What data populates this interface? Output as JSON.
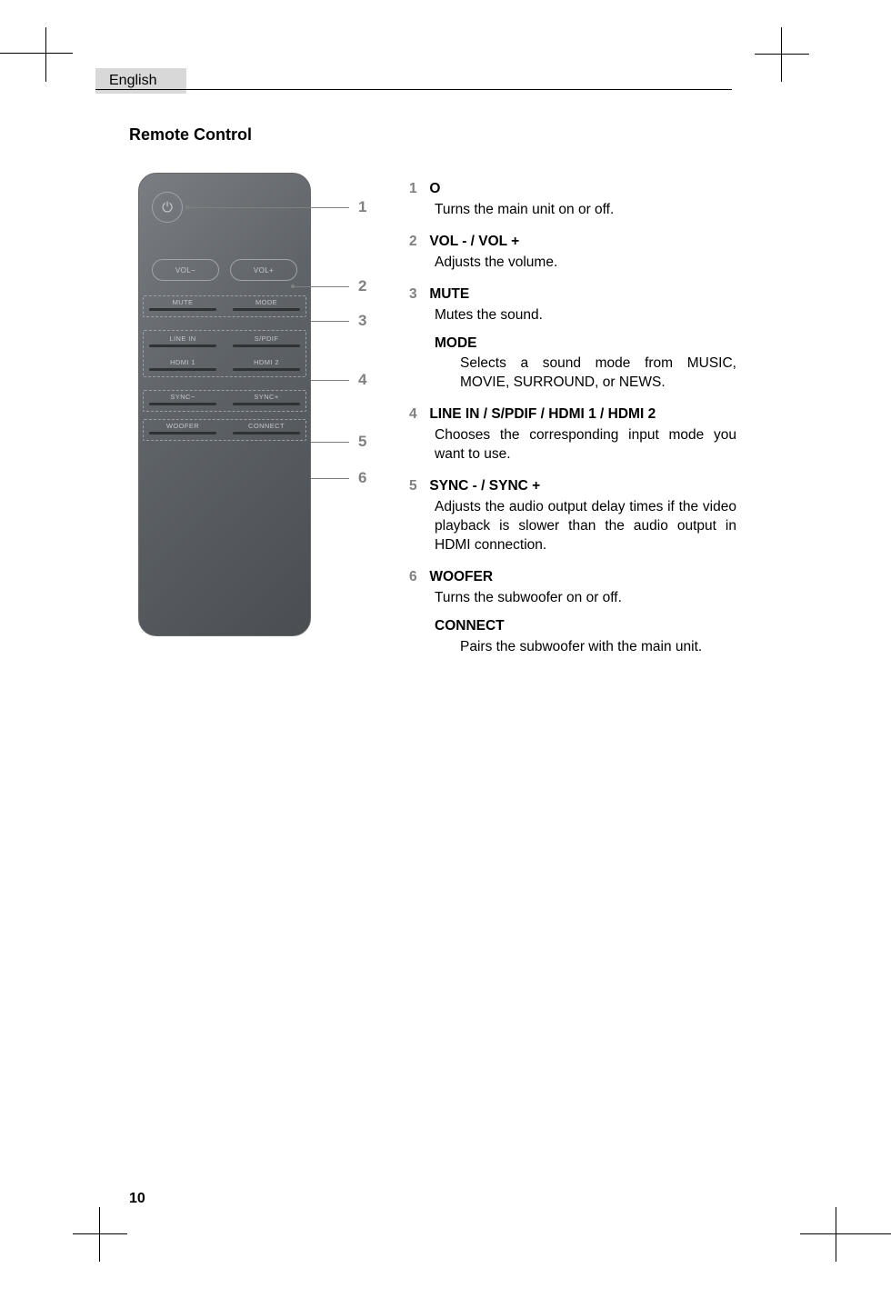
{
  "header": {
    "language": "English"
  },
  "section_title": "Remote Control",
  "remote": {
    "power_glyph": "⏻",
    "rows": {
      "vol": {
        "left": "VOL−",
        "right": "VOL+"
      },
      "mute_mode": {
        "left": "MUTE",
        "right": "MODE"
      },
      "input1": {
        "left": "LINE IN",
        "right": "S/PDIF"
      },
      "input2": {
        "left": "HDMI 1",
        "right": "HDMI 2"
      },
      "sync": {
        "left": "SYNC−",
        "right": "SYNC+"
      },
      "woofer": {
        "left": "WOOFER",
        "right": "CONNECT"
      }
    }
  },
  "callouts": {
    "c1": "1",
    "c2": "2",
    "c3": "3",
    "c4": "4",
    "c5": "5",
    "c6": "6"
  },
  "descriptions": [
    {
      "num": "1",
      "title": "O",
      "body": "Turns the main unit on or off."
    },
    {
      "num": "2",
      "title": "VOL - / VOL +",
      "body": "Adjusts the volume."
    },
    {
      "num": "3",
      "title": "MUTE",
      "body": "Mutes the sound.",
      "sub": {
        "title": "MODE",
        "body": "Selects a sound mode from MUSIC, MOVIE, SURROUND, or NEWS."
      }
    },
    {
      "num": "4",
      "title": "LINE IN / S/PDIF / HDMI 1 / HDMI 2",
      "body": "Chooses the corresponding input mode you want to use."
    },
    {
      "num": "5",
      "title": "SYNC - / SYNC +",
      "body": "Adjusts the audio output delay times if the video playback is slower than the audio output in HDMI connection."
    },
    {
      "num": "6",
      "title": "WOOFER",
      "body": "Turns the subwoofer on or off.",
      "sub": {
        "title": "CONNECT",
        "body": "Pairs the subwoofer with the main unit."
      }
    }
  ],
  "page_number": "10"
}
